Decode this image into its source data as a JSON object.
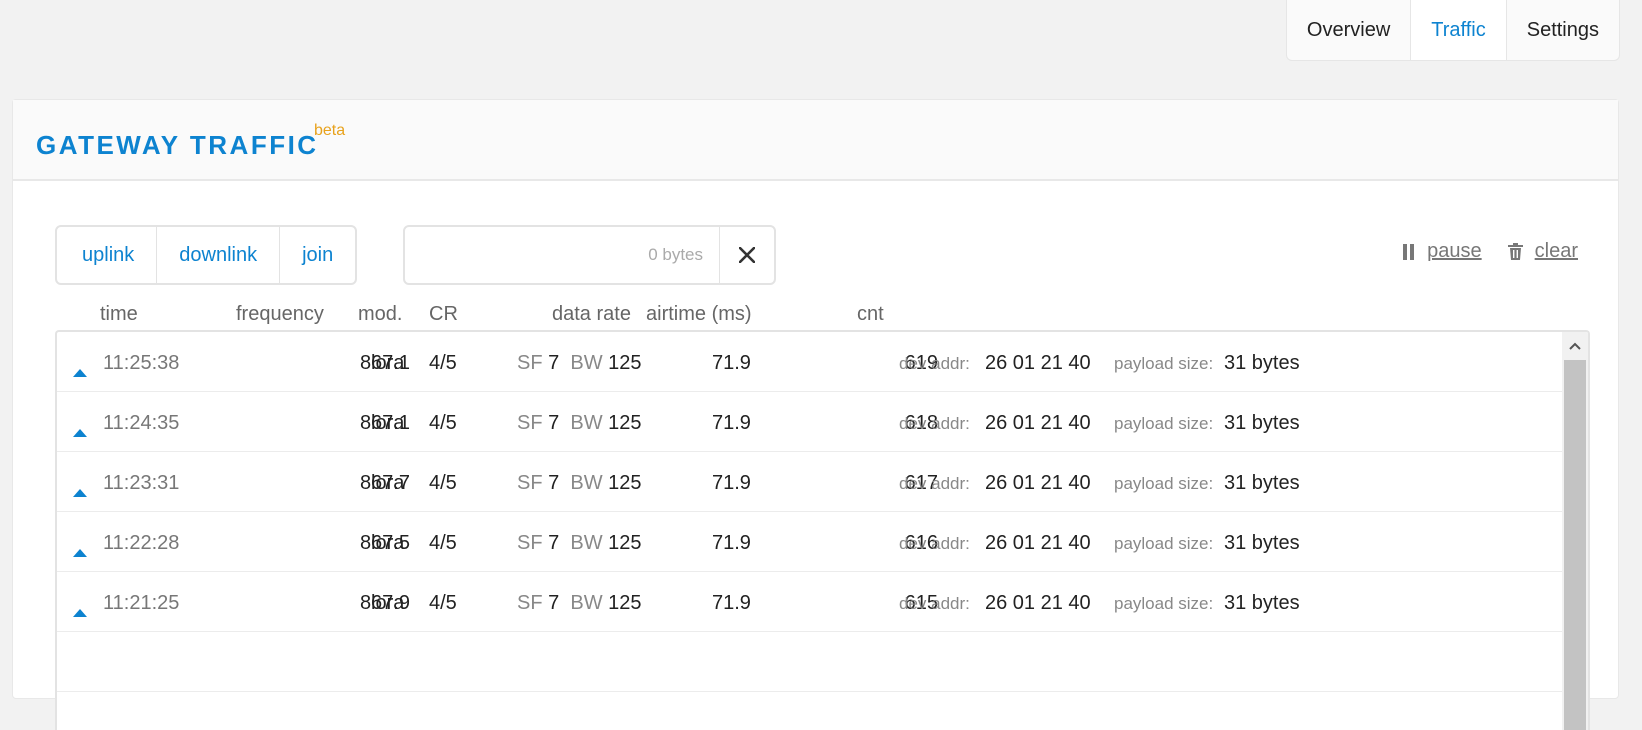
{
  "nav": {
    "tabs": [
      {
        "label": "Overview"
      },
      {
        "label": "Traffic"
      },
      {
        "label": "Settings"
      }
    ]
  },
  "panel": {
    "title": "Gateway Traffic",
    "badge": "beta"
  },
  "filters": {
    "buttons": [
      "uplink",
      "downlink",
      "join"
    ],
    "search_placeholder": "0 bytes"
  },
  "actions": {
    "pause_label": "pause",
    "clear_label": "clear"
  },
  "columns": {
    "time": "time",
    "frequency": "frequency",
    "mod": "mod.",
    "cr": "CR",
    "data_rate": "data rate",
    "airtime": "airtime (ms)",
    "cnt": "cnt"
  },
  "rows": [
    {
      "time": "11:25:38",
      "freq": "867.1",
      "mod": "lora",
      "cr": "4/5",
      "sf_label": "SF",
      "sf": "7",
      "bw_label": "BW",
      "bw": "125",
      "air": "71.9",
      "cnt": "619",
      "dev_label": "dev addr:",
      "dev": "26 01 21 40",
      "pl_label": "payload size:",
      "pl": "31 bytes"
    },
    {
      "time": "11:24:35",
      "freq": "867.1",
      "mod": "lora",
      "cr": "4/5",
      "sf_label": "SF",
      "sf": "7",
      "bw_label": "BW",
      "bw": "125",
      "air": "71.9",
      "cnt": "618",
      "dev_label": "dev addr:",
      "dev": "26 01 21 40",
      "pl_label": "payload size:",
      "pl": "31 bytes"
    },
    {
      "time": "11:23:31",
      "freq": "867.7",
      "mod": "lora",
      "cr": "4/5",
      "sf_label": "SF",
      "sf": "7",
      "bw_label": "BW",
      "bw": "125",
      "air": "71.9",
      "cnt": "617",
      "dev_label": "dev addr:",
      "dev": "26 01 21 40",
      "pl_label": "payload size:",
      "pl": "31 bytes"
    },
    {
      "time": "11:22:28",
      "freq": "867.5",
      "mod": "lora",
      "cr": "4/5",
      "sf_label": "SF",
      "sf": "7",
      "bw_label": "BW",
      "bw": "125",
      "air": "71.9",
      "cnt": "616",
      "dev_label": "dev addr:",
      "dev": "26 01 21 40",
      "pl_label": "payload size:",
      "pl": "31 bytes"
    },
    {
      "time": "11:21:25",
      "freq": "867.9",
      "mod": "lora",
      "cr": "4/5",
      "sf_label": "SF",
      "sf": "7",
      "bw_label": "BW",
      "bw": "125",
      "air": "71.9",
      "cnt": "615",
      "dev_label": "dev addr:",
      "dev": "26 01 21 40",
      "pl_label": "payload size:",
      "pl": "31 bytes"
    },
    {
      "time": "",
      "freq": "",
      "mod": "",
      "cr": "",
      "sf_label": "",
      "sf": "",
      "bw_label": "",
      "bw": "",
      "air": "",
      "cnt": "",
      "dev_label": "",
      "dev": "",
      "pl_label": "",
      "pl": ""
    }
  ],
  "colors": {
    "accent": "#0d83d0",
    "beta": "#e8a21c"
  }
}
